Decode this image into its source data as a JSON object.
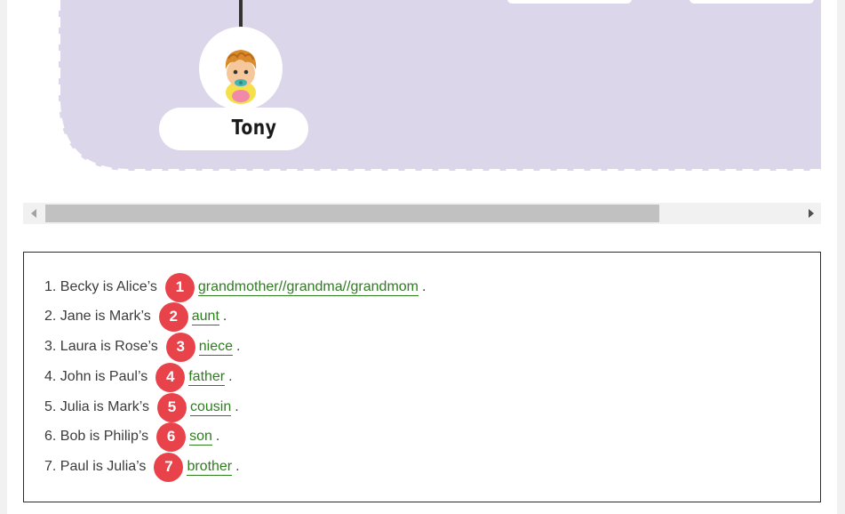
{
  "tree": {
    "person_name": "Tony",
    "panel_color": "#dcd6ea"
  },
  "scrollbar": {
    "left_arrow": "scroll-left-arrow",
    "right_arrow": "scroll-right-arrow"
  },
  "exercise": {
    "questions": [
      {
        "prompt": "1. Becky is Alice’s",
        "number": "1",
        "answer": "grandmother//grandma//grandmom",
        "end": "."
      },
      {
        "prompt": "2. Jane is Mark’s",
        "number": "2",
        "answer": "aunt",
        "end": "."
      },
      {
        "prompt": "3. Laura is Rose’s",
        "number": "3",
        "answer": "niece",
        "end": "."
      },
      {
        "prompt": "4. John is Paul’s",
        "number": "4",
        "answer": "father",
        "end": "."
      },
      {
        "prompt": "5. Julia is Mark’s",
        "number": "5",
        "answer": "cousin",
        "end": "."
      },
      {
        "prompt": "6. Bob is Philip’s",
        "number": "6",
        "answer": "son",
        "end": "."
      },
      {
        "prompt": "7. Paul is Julia’s",
        "number": "7",
        "answer": "brother",
        "end": "."
      }
    ],
    "badge_color": "#e8434b",
    "answer_color": "#2e7d1f"
  }
}
